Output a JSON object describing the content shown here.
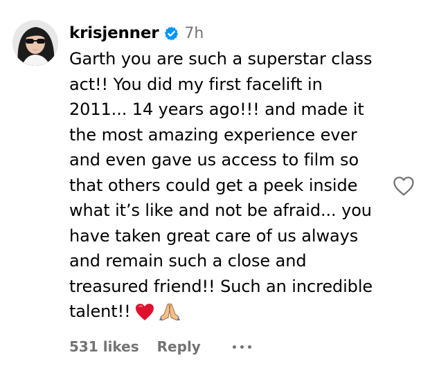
{
  "comment": {
    "username": "krisjenner",
    "verified": true,
    "timestamp": "7h",
    "text": "Garth you are such a superstar class act!! You did my first facelift in 2011... 14 years ago!!! and made it the most amazing experience ever and even gave us access to film so that others could get a peek inside what it’s like and not be afraid... you have taken great care of us always and remain such a close and treasured friend!! Such an incredible talent!!",
    "emojis": [
      "red-heart",
      "folded-hands"
    ],
    "likes_label": "531 likes",
    "reply_label": "Reply"
  },
  "colors": {
    "text": "#000000",
    "secondary": "#737373",
    "verified_blue": "#0095f6",
    "heart_red": "#e0102f"
  },
  "icons": {
    "avatar": "profile-avatar",
    "verified": "verified-badge-icon",
    "like": "heart-outline-icon",
    "more": "more-horizontal-icon"
  }
}
